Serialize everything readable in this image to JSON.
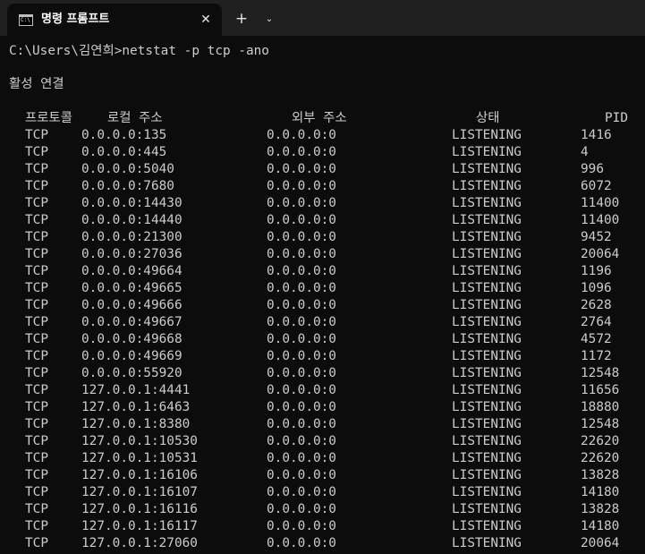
{
  "tab": {
    "icon_text": "C:\\",
    "title": "명령 프롬프트",
    "close_glyph": "✕",
    "new_tab_glyph": "+",
    "dropdown_glyph": "⌄"
  },
  "console": {
    "prompt": "C:\\Users\\김연희>",
    "command": "netstat -p tcp -ano",
    "section_title": "활성 연결",
    "headers": {
      "proto": "프로토콜",
      "local": "로컬 주소",
      "foreign": "외부 주소",
      "state": "상태",
      "pid": "PID"
    },
    "rows": [
      {
        "proto": "TCP",
        "local": "0.0.0.0:135",
        "foreign": "0.0.0.0:0",
        "state": "LISTENING",
        "pid": "1416"
      },
      {
        "proto": "TCP",
        "local": "0.0.0.0:445",
        "foreign": "0.0.0.0:0",
        "state": "LISTENING",
        "pid": "4"
      },
      {
        "proto": "TCP",
        "local": "0.0.0.0:5040",
        "foreign": "0.0.0.0:0",
        "state": "LISTENING",
        "pid": "996"
      },
      {
        "proto": "TCP",
        "local": "0.0.0.0:7680",
        "foreign": "0.0.0.0:0",
        "state": "LISTENING",
        "pid": "6072"
      },
      {
        "proto": "TCP",
        "local": "0.0.0.0:14430",
        "foreign": "0.0.0.0:0",
        "state": "LISTENING",
        "pid": "11400"
      },
      {
        "proto": "TCP",
        "local": "0.0.0.0:14440",
        "foreign": "0.0.0.0:0",
        "state": "LISTENING",
        "pid": "11400"
      },
      {
        "proto": "TCP",
        "local": "0.0.0.0:21300",
        "foreign": "0.0.0.0:0",
        "state": "LISTENING",
        "pid": "9452"
      },
      {
        "proto": "TCP",
        "local": "0.0.0.0:27036",
        "foreign": "0.0.0.0:0",
        "state": "LISTENING",
        "pid": "20064"
      },
      {
        "proto": "TCP",
        "local": "0.0.0.0:49664",
        "foreign": "0.0.0.0:0",
        "state": "LISTENING",
        "pid": "1196"
      },
      {
        "proto": "TCP",
        "local": "0.0.0.0:49665",
        "foreign": "0.0.0.0:0",
        "state": "LISTENING",
        "pid": "1096"
      },
      {
        "proto": "TCP",
        "local": "0.0.0.0:49666",
        "foreign": "0.0.0.0:0",
        "state": "LISTENING",
        "pid": "2628"
      },
      {
        "proto": "TCP",
        "local": "0.0.0.0:49667",
        "foreign": "0.0.0.0:0",
        "state": "LISTENING",
        "pid": "2764"
      },
      {
        "proto": "TCP",
        "local": "0.0.0.0:49668",
        "foreign": "0.0.0.0:0",
        "state": "LISTENING",
        "pid": "4572"
      },
      {
        "proto": "TCP",
        "local": "0.0.0.0:49669",
        "foreign": "0.0.0.0:0",
        "state": "LISTENING",
        "pid": "1172"
      },
      {
        "proto": "TCP",
        "local": "0.0.0.0:55920",
        "foreign": "0.0.0.0:0",
        "state": "LISTENING",
        "pid": "12548"
      },
      {
        "proto": "TCP",
        "local": "127.0.0.1:4441",
        "foreign": "0.0.0.0:0",
        "state": "LISTENING",
        "pid": "11656"
      },
      {
        "proto": "TCP",
        "local": "127.0.0.1:6463",
        "foreign": "0.0.0.0:0",
        "state": "LISTENING",
        "pid": "18880"
      },
      {
        "proto": "TCP",
        "local": "127.0.0.1:8380",
        "foreign": "0.0.0.0:0",
        "state": "LISTENING",
        "pid": "12548"
      },
      {
        "proto": "TCP",
        "local": "127.0.0.1:10530",
        "foreign": "0.0.0.0:0",
        "state": "LISTENING",
        "pid": "22620"
      },
      {
        "proto": "TCP",
        "local": "127.0.0.1:10531",
        "foreign": "0.0.0.0:0",
        "state": "LISTENING",
        "pid": "22620"
      },
      {
        "proto": "TCP",
        "local": "127.0.0.1:16106",
        "foreign": "0.0.0.0:0",
        "state": "LISTENING",
        "pid": "13828"
      },
      {
        "proto": "TCP",
        "local": "127.0.0.1:16107",
        "foreign": "0.0.0.0:0",
        "state": "LISTENING",
        "pid": "14180"
      },
      {
        "proto": "TCP",
        "local": "127.0.0.1:16116",
        "foreign": "0.0.0.0:0",
        "state": "LISTENING",
        "pid": "13828"
      },
      {
        "proto": "TCP",
        "local": "127.0.0.1:16117",
        "foreign": "0.0.0.0:0",
        "state": "LISTENING",
        "pid": "14180"
      },
      {
        "proto": "TCP",
        "local": "127.0.0.1:27060",
        "foreign": "0.0.0.0:0",
        "state": "LISTENING",
        "pid": "20064"
      }
    ]
  },
  "colors": {
    "titlebar": "#202020",
    "console_bg": "#0c0c0c",
    "console_text": "#cccccc",
    "tab_title_text": "#ffffff"
  }
}
